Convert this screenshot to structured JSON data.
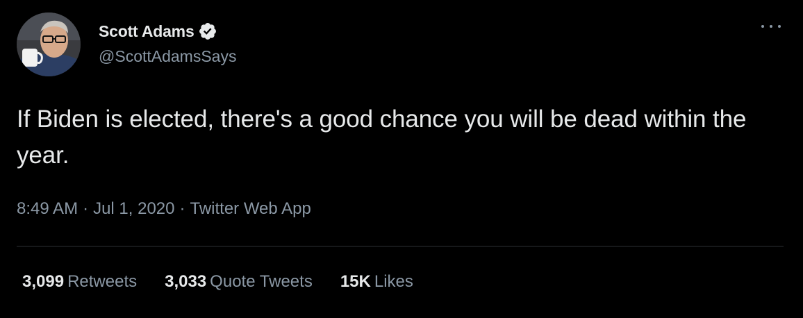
{
  "author": {
    "name": "Scott Adams",
    "handle": "@ScottAdamsSays",
    "verified": true
  },
  "tweet": {
    "text": "If Biden is elected, there's a good chance you will be dead within the year.",
    "time": "8:49 AM",
    "date": "Jul 1, 2020",
    "separator": "·",
    "source": "Twitter Web App"
  },
  "stats": {
    "retweets": {
      "count": "3,099",
      "label": "Retweets"
    },
    "quote_tweets": {
      "count": "3,033",
      "label": "Quote Tweets"
    },
    "likes": {
      "count": "15K",
      "label": "Likes"
    }
  },
  "icons": {
    "verified": "verified-badge-icon",
    "more": "more-options-icon"
  },
  "colors": {
    "background": "#000000",
    "primary_text": "#e7e9ea",
    "secondary_text": "#8b98a5",
    "divider": "#2f3336",
    "badge": "#e7e9ea"
  }
}
